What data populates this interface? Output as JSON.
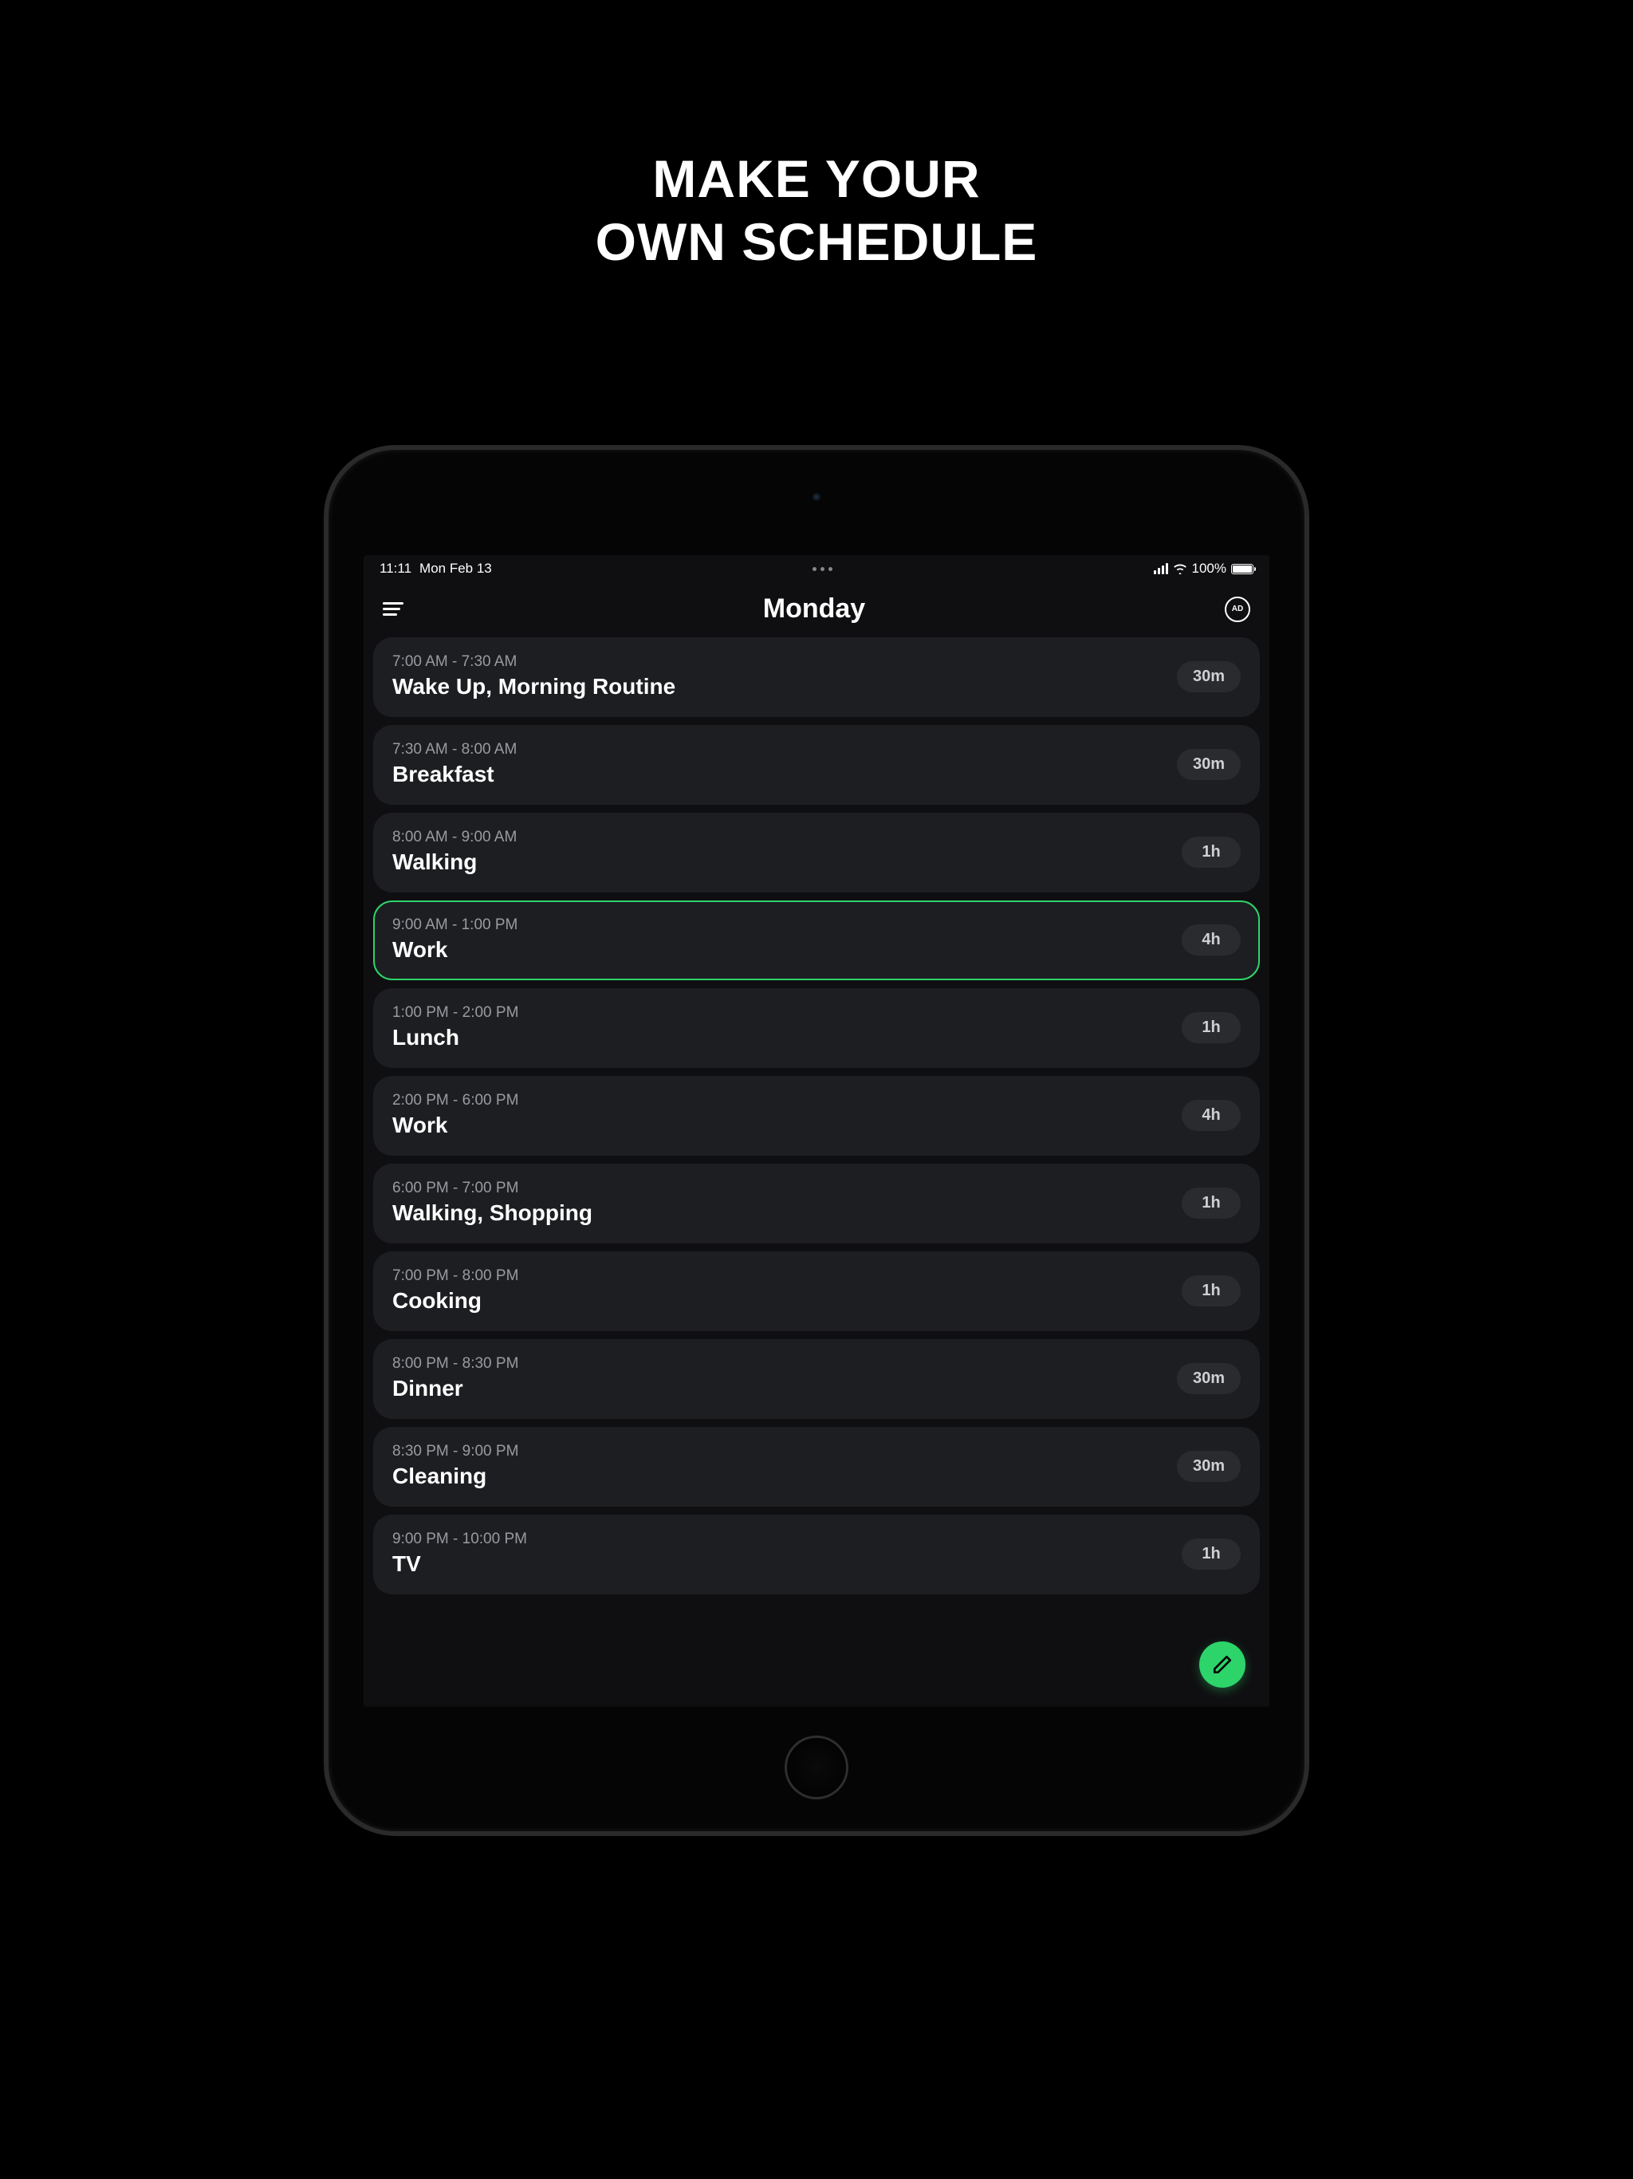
{
  "promo": {
    "line1": "MAKE YOUR",
    "line2": "OWN SCHEDULE"
  },
  "status_bar": {
    "time": "11:11",
    "date": "Mon Feb 13",
    "battery_pct": "100%"
  },
  "nav": {
    "title": "Monday",
    "ad_label": "AD"
  },
  "schedule": [
    {
      "time_range": "7:00 AM - 7:30 AM",
      "title": "Wake Up, Morning Routine",
      "duration": "30m",
      "active": false
    },
    {
      "time_range": "7:30 AM - 8:00 AM",
      "title": "Breakfast",
      "duration": "30m",
      "active": false
    },
    {
      "time_range": "8:00 AM - 9:00 AM",
      "title": "Walking",
      "duration": "1h",
      "active": false
    },
    {
      "time_range": "9:00 AM - 1:00 PM",
      "title": "Work",
      "duration": "4h",
      "active": true
    },
    {
      "time_range": "1:00 PM - 2:00 PM",
      "title": "Lunch",
      "duration": "1h",
      "active": false
    },
    {
      "time_range": "2:00 PM - 6:00 PM",
      "title": "Work",
      "duration": "4h",
      "active": false
    },
    {
      "time_range": "6:00 PM - 7:00 PM",
      "title": "Walking, Shopping",
      "duration": "1h",
      "active": false
    },
    {
      "time_range": "7:00 PM - 8:00 PM",
      "title": "Cooking",
      "duration": "1h",
      "active": false
    },
    {
      "time_range": "8:00 PM - 8:30 PM",
      "title": "Dinner",
      "duration": "30m",
      "active": false
    },
    {
      "time_range": "8:30 PM - 9:00 PM",
      "title": "Cleaning",
      "duration": "30m",
      "active": false
    },
    {
      "time_range": "9:00 PM - 10:00 PM",
      "title": "TV",
      "duration": "1h",
      "active": false
    }
  ]
}
